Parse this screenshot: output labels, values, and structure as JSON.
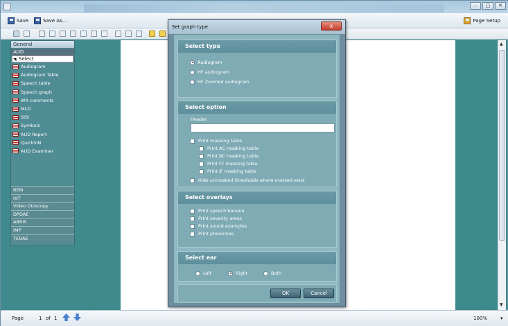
{
  "toolbar": {
    "save_label": "Save",
    "save_as_label": "Save As...",
    "page_setup_label": "Page Setup"
  },
  "sidebar": {
    "header": "General",
    "selected_group": "AUD",
    "select_item": "Select",
    "items": [
      "Audiogram",
      "Audiogram Table",
      "Speech table",
      "Speech graph",
      "WR comments",
      "MLD",
      "SISI",
      "Symbols",
      "AUD Report",
      "QuickSIN",
      "AUD Examiner"
    ],
    "groups": [
      "REM",
      "HIT",
      "Video Otoscopy",
      "DPOAE",
      "ABRIS",
      "IMP",
      "TEOAE"
    ]
  },
  "status": {
    "page_label": "Page",
    "page_current": "1",
    "of_label": "of",
    "page_total": "1",
    "zoom": "100%"
  },
  "dialog": {
    "title": "Set graph type",
    "close_glyph": "x",
    "select_type": {
      "title": "Select type",
      "options": [
        {
          "label": "Audiogram",
          "selected": true
        },
        {
          "label": "HF audiogram",
          "selected": false
        },
        {
          "label": "HF Zoomed audiogram",
          "selected": false
        }
      ]
    },
    "select_option": {
      "title": "Select option",
      "header_label": "Header",
      "header_value": "",
      "print_masking_table": "Print masking table",
      "sub_options": [
        "Print AC masking table",
        "Print BC masking table",
        "Print FF masking table",
        "Print IF masking table"
      ],
      "hide_unmasked": "Hide unmasked thresholds where masked exist"
    },
    "select_overlays": {
      "title": "Select overlays",
      "options": [
        "Print speech banana",
        "Print severity areas",
        "Print sound examples",
        "Print phonemes"
      ]
    },
    "select_ear": {
      "title": "Select ear",
      "options": [
        {
          "label": "Left",
          "selected": false
        },
        {
          "label": "Right",
          "selected": true
        },
        {
          "label": "Both",
          "selected": false
        }
      ]
    },
    "ok_label": "OK",
    "cancel_label": "Cancel"
  },
  "colors": {
    "app_background": "#3f8a8c",
    "dialog_section": "#7fabb5",
    "selected_group": "#56707e",
    "close_button": "#c4402d"
  }
}
